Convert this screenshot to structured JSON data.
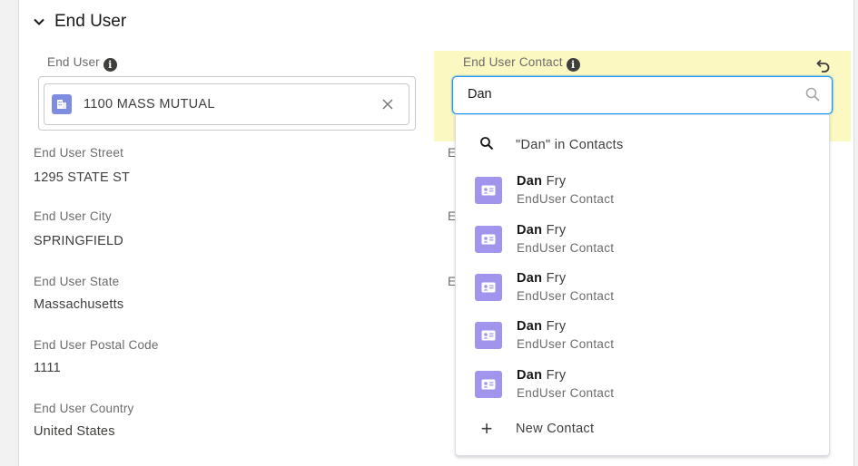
{
  "section": {
    "title": "End User"
  },
  "fields": {
    "end_user": {
      "label": "End User",
      "value": "1100 MASS MUTUAL"
    },
    "end_user_contact": {
      "label": "End User Contact",
      "value": "Dan"
    },
    "street": {
      "label": "End User Street",
      "value": "1295 STATE ST"
    },
    "city": {
      "label": "End User City",
      "value": "SPRINGFIELD"
    },
    "state": {
      "label": "End User State",
      "value": "Massachusetts"
    },
    "postal": {
      "label": "End User Postal Code",
      "value": "1111"
    },
    "country": {
      "label": "End User Country",
      "value": "United States"
    }
  },
  "clipped_labels": [
    "E",
    "E",
    "E"
  ],
  "dropdown": {
    "search_label": "\"Dan\" in Contacts",
    "results": [
      {
        "first": "Dan",
        "last": "Fry",
        "meta": "EndUser Contact"
      },
      {
        "first": "Dan",
        "last": "Fry",
        "meta": "EndUser Contact"
      },
      {
        "first": "Dan",
        "last": "Fry",
        "meta": "EndUser Contact"
      },
      {
        "first": "Dan",
        "last": "Fry",
        "meta": "EndUser Contact"
      },
      {
        "first": "Dan",
        "last": "Fry",
        "meta": "EndUser Contact"
      }
    ],
    "new_label": "New Contact"
  },
  "icons": {
    "section_toggle": "chevron-down-icon",
    "info": "info-icon",
    "account": "account-icon",
    "remove": "close-icon",
    "search": "search-icon",
    "undo": "undo-icon",
    "contact": "contact-icon",
    "add": "plus-icon"
  },
  "colors": {
    "highlight": "#fbf8c2",
    "focus_border": "#1b96ff",
    "account_icon": "#7f8de1",
    "contact_icon": "#a094ed"
  }
}
